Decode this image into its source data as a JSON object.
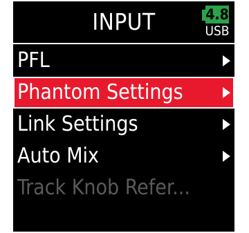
{
  "header": {
    "title": "INPUT",
    "battery_level": "4.8",
    "power_source": "USB"
  },
  "menu": {
    "items": [
      {
        "label": "PFL",
        "has_submenu": true,
        "selected": false,
        "enabled": true
      },
      {
        "label": "Phantom Settings",
        "has_submenu": true,
        "selected": true,
        "enabled": true
      },
      {
        "label": "Link Settings",
        "has_submenu": true,
        "selected": false,
        "enabled": true
      },
      {
        "label": "Auto Mix",
        "has_submenu": true,
        "selected": false,
        "enabled": true
      },
      {
        "label": "Track Knob   Refer...",
        "has_submenu": false,
        "selected": false,
        "enabled": false
      }
    ]
  },
  "colors": {
    "background": "#000000",
    "highlight": "#e8192c",
    "battery": "#2aa34a",
    "disabled_text": "#5a5a5a"
  }
}
